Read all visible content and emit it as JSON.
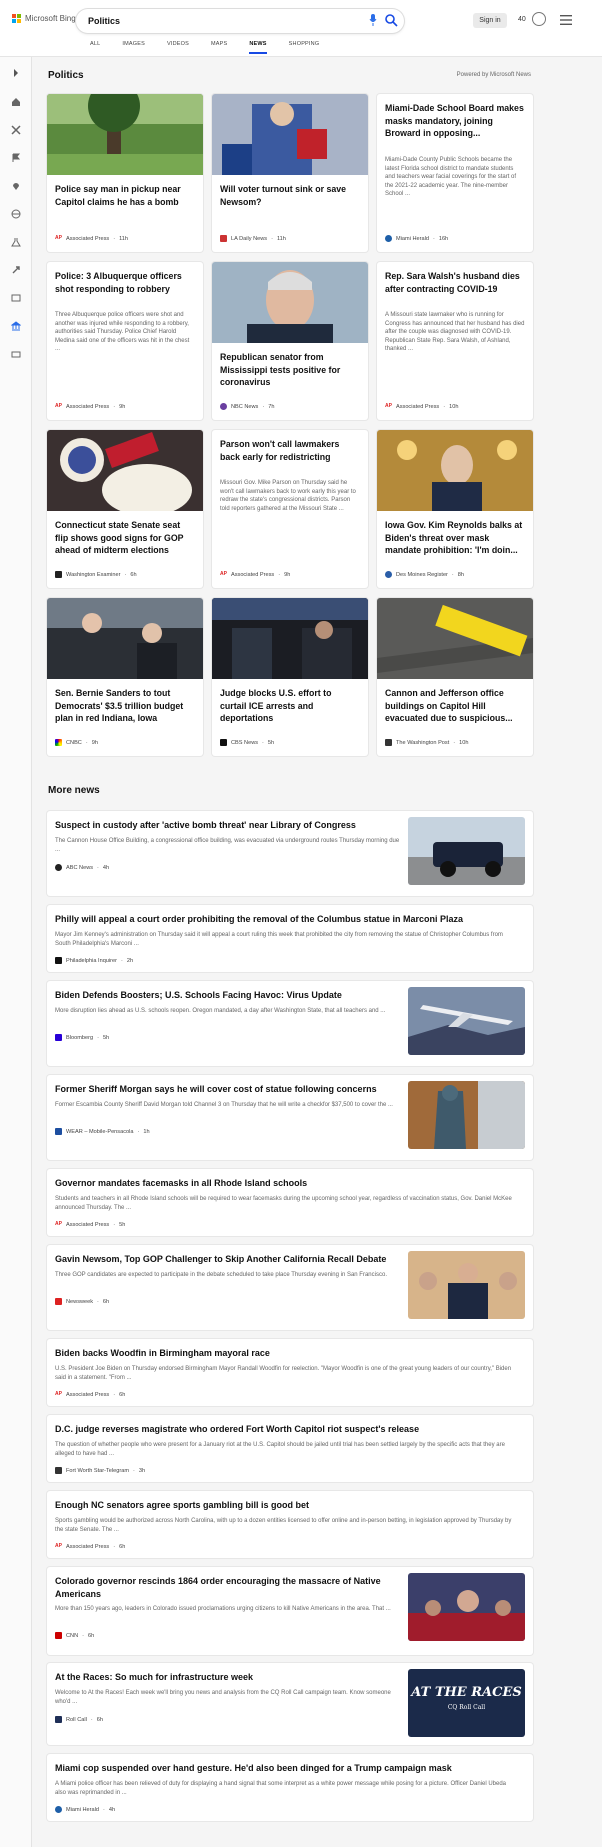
{
  "header": {
    "brand": "Microsoft Bing",
    "query": "Politics",
    "signin": "Sign in",
    "points": "40"
  },
  "tabs": [
    "ALL",
    "IMAGES",
    "VIDEOS",
    "MAPS",
    "NEWS",
    "SHOPPING"
  ],
  "section": {
    "title": "Politics",
    "powered": "Powered by Microsoft News"
  },
  "cards": [
    {
      "title": "Police say man in pickup near Capitol claims he has a bomb",
      "source": "Associated Press",
      "age": "11h"
    },
    {
      "title": "Will voter turnout sink or save Newsom?",
      "source": "LA Daily News",
      "age": "11h"
    },
    {
      "title": "Miami-Dade School Board makes masks mandatory, joining Broward in opposing...",
      "summary": "Miami-Dade County Public Schools became the latest Florida school district to mandate students and teachers wear facial coverings for the start of the 2021-22 academic year. The nine-member School ...",
      "source": "Miami Herald",
      "age": "16h"
    },
    {
      "title": "Police: 3 Albuquerque officers shot responding to robbery",
      "summary": "Three Albuquerque police officers were shot and another was injured while responding to a robbery, authorities said Thursday. Police Chief Harold Medina said one of the officers was hit in the chest ...",
      "source": "Associated Press",
      "age": "9h"
    },
    {
      "title": "Republican senator from Mississippi tests positive for coronavirus",
      "source": "NBC News",
      "age": "7h"
    },
    {
      "title": "Rep. Sara Walsh's husband dies after contracting COVID-19",
      "summary": "A Missouri state lawmaker who is running for Congress has announced that her husband has died after the couple was diagnosed with COVID-19. Republican State Rep. Sara Walsh, of Ashland, thanked ...",
      "source": "Associated Press",
      "age": "10h"
    },
    {
      "title": "Connecticut state Senate seat flip shows good signs for GOP ahead of midterm elections",
      "source": "Washington Examiner",
      "age": "6h"
    },
    {
      "title": "Parson won't call lawmakers back early for redistricting",
      "summary": "Missouri Gov. Mike Parson on Thursday said he won't call lawmakers back to work early this year to redraw the state's congressional districts. Parson told reporters gathered at the Missouri State ...",
      "source": "Associated Press",
      "age": "9h"
    },
    {
      "title": "Iowa Gov. Kim Reynolds balks at Biden's threat over mask mandate prohibition: 'I'm doin...",
      "source": "Des Moines Register",
      "age": "8h"
    },
    {
      "title": "Sen. Bernie Sanders to tout Democrats' $3.5 trillion budget plan in red Indiana, Iowa",
      "source": "CNBC",
      "age": "9h"
    },
    {
      "title": "Judge blocks U.S. effort to curtail ICE arrests and deportations",
      "source": "CBS News",
      "age": "5h"
    },
    {
      "title": "Cannon and Jefferson office buildings on Capitol Hill evacuated due to suspicious...",
      "source": "The Washington Post",
      "age": "10h"
    }
  ],
  "more": {
    "title": "More news",
    "items": [
      {
        "title": "Suspect in custody after 'active bomb threat' near Library of Congress",
        "summary": "The Cannon House Office Building, a congressional office building, was evacuated via underground routes Thursday morning due ...",
        "source": "ABC News",
        "age": "4h"
      },
      {
        "title": "Philly will appeal a court order prohibiting the removal of the Columbus statue in Marconi Plaza",
        "summary": "Mayor Jim Kenney's administration on Thursday said it will appeal a court ruling this week that prohibited the city from removing the statue of Christopher Columbus from South Philadelphia's Marconi ...",
        "source": "Philadelphia Inquirer",
        "age": "2h"
      },
      {
        "title": "Biden Defends Boosters; U.S. Schools Facing Havoc: Virus Update",
        "summary": "More disruption lies ahead as U.S. schools reopen. Oregon mandated, a day after Washington State, that all teachers and ...",
        "source": "Bloomberg",
        "age": "5h"
      },
      {
        "title": "Former Sheriff Morgan says he will cover cost of statue following concerns",
        "summary": "Former Escambia County Sheriff David Morgan told Channel 3 on Thursday that he will write a checkfor $37,500 to cover the ...",
        "source": "WEAR – Mobile-Pensacola",
        "age": "1h"
      },
      {
        "title": "Governor mandates facemasks in all Rhode Island schools",
        "summary": "Students and teachers in all Rhode Island schools will be required to wear facemasks during the upcoming school year, regardless of vaccination status, Gov. Daniel McKee announced Thursday. The ...",
        "source": "Associated Press",
        "age": "5h"
      },
      {
        "title": "Gavin Newsom, Top GOP Challenger to Skip Another California Recall Debate",
        "summary": "Three GOP candidates are expected to participate in the debate scheduled to take place Thursday evening in San Francisco.",
        "source": "Newsweek",
        "age": "6h"
      },
      {
        "title": "Biden backs Woodfin in Birmingham mayoral race",
        "summary": "U.S. President Joe Biden on Thursday endorsed Birmingham Mayor Randall Woodfin for reelection. \"Mayor Woodfin is one of the great young leaders of our country,\" Biden said in a statement. \"From ...",
        "source": "Associated Press",
        "age": "6h"
      },
      {
        "title": "D.C. judge reverses magistrate who ordered Fort Worth Capitol riot suspect's release",
        "summary": "The question of whether people who were present for a January riot at the U.S. Capitol should be jailed until trial has been settled largely by the specific acts that they are alleged to have had ...",
        "source": "Fort Worth Star-Telegram",
        "age": "3h"
      },
      {
        "title": "Enough NC senators agree sports gambling bill is good bet",
        "summary": "Sports gambling would be authorized across North Carolina, with up to a dozen entities licensed to offer online and in-person betting, in legislation approved by Thursday by the state Senate. The ...",
        "source": "Associated Press",
        "age": "6h"
      },
      {
        "title": "Colorado governor rescinds 1864 order encouraging the massacre of Native Americans",
        "summary": "More than 150 years ago, leaders in Colorado issued proclamations urging citizens to kill Native Americans in the area. That ...",
        "source": "CNN",
        "age": "6h"
      },
      {
        "title": "At the Races: So much for infrastructure week",
        "summary": "Welcome to At the Races! Each week we'll bring you news and analysis from the CQ Roll Call campaign team. Know someone who'd ...",
        "source": "Roll Call",
        "age": "6h",
        "thumb_text": "AT THE RACES",
        "thumb_sub": "CQ Roll Call"
      },
      {
        "title": "Miami cop suspended over hand gesture. He'd also been dinged for a Trump campaign mask",
        "summary": "A Miami police officer has been relieved of duty for displaying a hand signal that some interpret as a white power message while posing for a picture. Officer Daniel Ubeda also was reprimanded in ...",
        "source": "Miami Herald",
        "age": "4h"
      }
    ]
  },
  "colors": {
    "accent": "#174ae4",
    "ap": "#d22",
    "la": "#c33",
    "herald": "#1e5fa8",
    "nbc": "#6a3fa0",
    "bloomberg": "#2800d7"
  }
}
